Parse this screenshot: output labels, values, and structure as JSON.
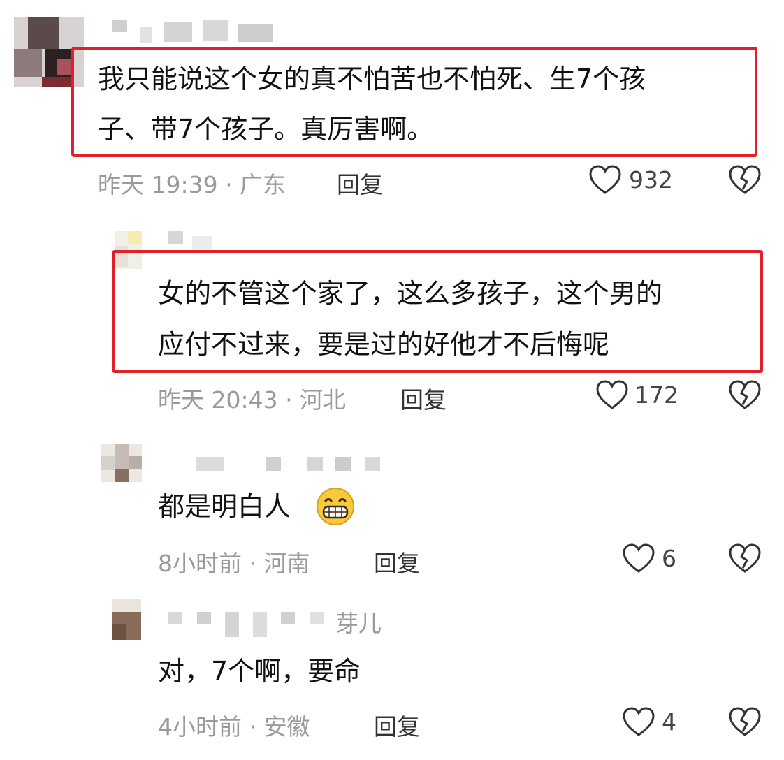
{
  "comments": [
    {
      "text_line1": "我只能说这个女的真不怕苦也不怕死、生7个孩",
      "text_line2": "子、带7个孩子。真厉害啊。",
      "meta": "昨天 19:39 · 广东",
      "reply_label": "回复",
      "likes": "932",
      "highlighted": true
    },
    {
      "text_line1": "女的不管这个家了，这么多孩子，这个男的",
      "text_line2": "应付不过来，要是过的好他才不后悔呢",
      "meta": "昨天 20:43 · 河北",
      "reply_label": "回复",
      "likes": "172",
      "highlighted": true
    },
    {
      "text_line1": "都是明白人",
      "emoji": "grinning-face",
      "meta": "8小时前 · 河南",
      "reply_label": "回复",
      "likes": "6",
      "highlighted": false
    },
    {
      "username_partial": "芽儿",
      "text_line1": "对，7个啊，要命",
      "meta": "4小时前 · 安徽",
      "reply_label": "回复",
      "likes": "4",
      "highlighted": false
    }
  ],
  "colors": {
    "highlight_border": "#e0202a",
    "meta_text": "#9a9a9a"
  },
  "icons": {
    "like": "heart-outline-icon",
    "dislike": "broken-heart-icon"
  }
}
